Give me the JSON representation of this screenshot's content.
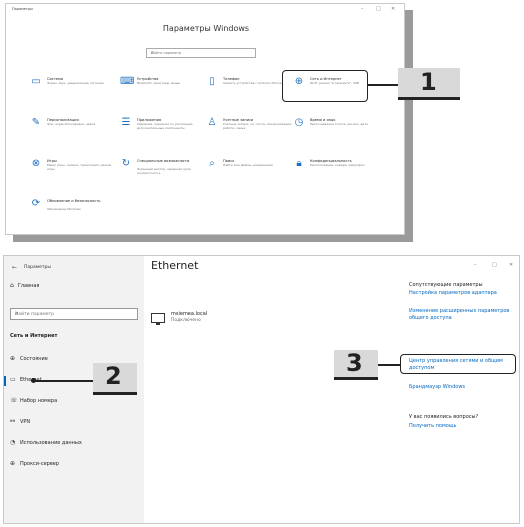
{
  "top_window": {
    "titlebar": "Параметры",
    "title": "Параметры Windows",
    "search_placeholder": "Найти параметр",
    "categories": [
      {
        "icon": "laptop-icon",
        "title": "Система",
        "desc": "Экран, звук, уведомления, питание"
      },
      {
        "icon": "devices-icon",
        "title": "Устройства",
        "desc": "Bluetooth, принтеры, мышь"
      },
      {
        "icon": "phone-icon",
        "title": "Телефон",
        "desc": "Связать устройства с Android, iPhone"
      },
      {
        "icon": "globe-icon",
        "title": "Сеть и Интернет",
        "desc": "Wi-Fi, режим \"в самолете\", VPN"
      },
      {
        "icon": "paint-icon",
        "title": "Персонализация",
        "desc": "Фон, экран блокировки, цвета"
      },
      {
        "icon": "apps-icon",
        "title": "Приложения",
        "desc": "Удаление, значения по умолчанию, дополнительные компоненты"
      },
      {
        "icon": "person-icon",
        "title": "Учетные записи",
        "desc": "Учетные записи, эл. почта, синхронизация, работа, семья"
      },
      {
        "icon": "clock-language-icon",
        "title": "Время и язык",
        "desc": "Распознавание голоса, регион, дата"
      },
      {
        "icon": "xbox-icon",
        "title": "Игры",
        "desc": "Меню игры, снимки, трансляция, режим игры"
      },
      {
        "icon": "accessibility-icon",
        "title": "Специальные возможности",
        "desc": "Экранный диктор, экранная лупа, контрастность"
      },
      {
        "icon": "search-icon",
        "title": "Поиск",
        "desc": "Найти мои файлы, разрешения"
      },
      {
        "icon": "lock-icon",
        "title": "Конфиденциальность",
        "desc": "Расположение, камера, микрофон"
      },
      {
        "icon": "update-icon",
        "title": "Обновление и безопасность",
        "desc": "Обновление Windows"
      }
    ],
    "callout": "1"
  },
  "bottom_window": {
    "titlebar": "Параметры",
    "home": "Главная",
    "search_placeholder": "Найти параметр",
    "section": "Сеть и Интернет",
    "nav": [
      {
        "icon": "status-icon",
        "label": "Состояние"
      },
      {
        "icon": "ethernet-icon",
        "label": "Ethernet"
      },
      {
        "icon": "dialup-icon",
        "label": "Набор номера"
      },
      {
        "icon": "vpn-icon",
        "label": "VPN"
      },
      {
        "icon": "data-usage-icon",
        "label": "Использование данных"
      },
      {
        "icon": "proxy-icon",
        "label": "Прокси-сервер"
      }
    ],
    "page_title": "Ethernet",
    "network": {
      "name": "msiemea.local",
      "status": "Подключено"
    },
    "related_heading": "Сопутствующие параметры",
    "related_links": [
      "Настройка параметров адаптера",
      "Изменение расширенных параметров общего доступа",
      "Центр управления сетями и общим доступом",
      "Брандмауэр Windows"
    ],
    "help_heading": "У вас появились вопросы?",
    "help_link": "Получить помощь",
    "callout2": "2",
    "callout3": "3"
  }
}
